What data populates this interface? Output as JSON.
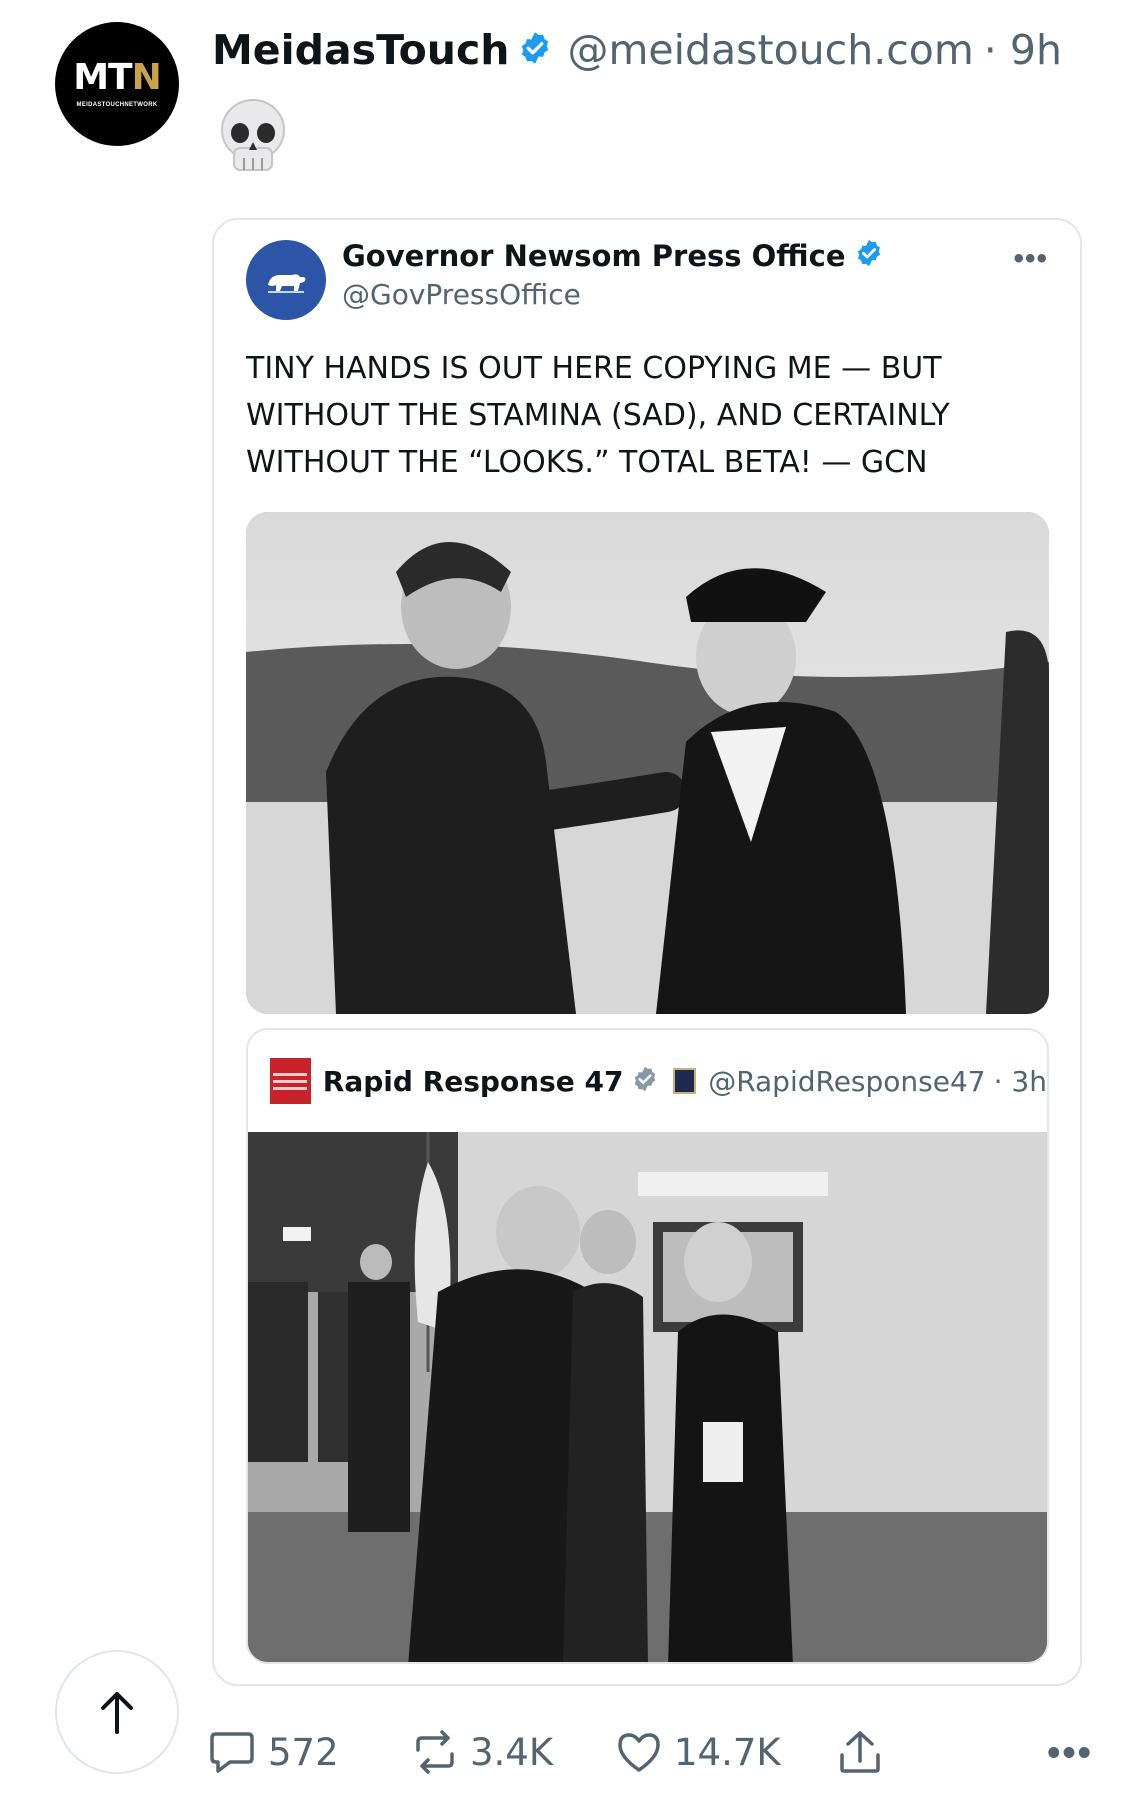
{
  "post": {
    "author": {
      "name": "MeidasTouch",
      "handle": "@meidastouch.com",
      "time": "· 9h",
      "avatar_text": "MTN",
      "avatar_sub": "MEIDASTOUCHNETWORK"
    },
    "text": "💀"
  },
  "quote": {
    "author": {
      "name": "Governor Newsom Press Office",
      "handle": "@GovPressOffice"
    },
    "more_icon": "more-horizontal-icon",
    "text": "TINY HANDS IS OUT HERE COPYING ME — BUT WITHOUT THE STAMINA (SAD), AND CERTAINLY WITHOUT THE “LOOKS.” TOTAL BETA! — GCN",
    "embed": {
      "name": "Rapid Response 47",
      "handle": "@RapidResponse47",
      "time": "· 3h"
    }
  },
  "actions": {
    "replies": "572",
    "reposts": "3.4K",
    "likes": "14.7K"
  },
  "colors": {
    "verified_blue": "#1d9bf0",
    "secondary_text": "#536471",
    "border": "#e1e6ea"
  }
}
